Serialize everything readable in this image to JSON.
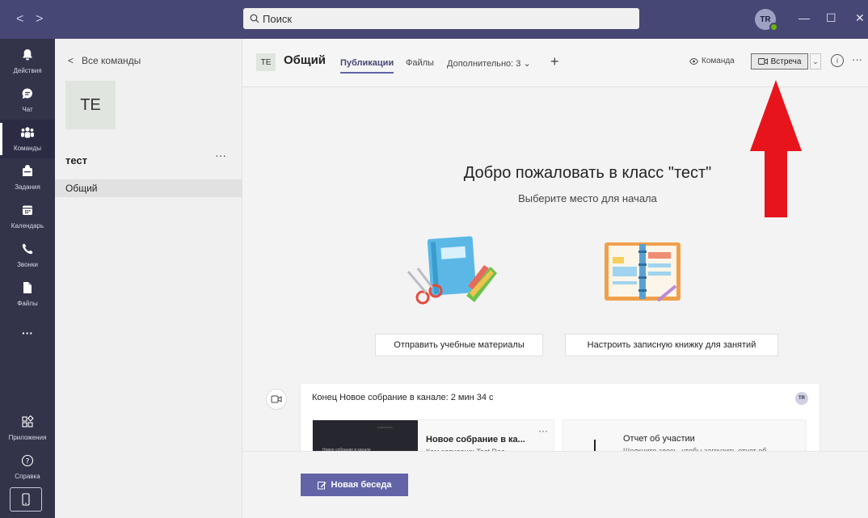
{
  "titlebar": {
    "search_placeholder": "Поиск",
    "avatar_initials": "TR",
    "window_controls": {
      "minimize": "—",
      "maximize": "☐",
      "close": "✕"
    }
  },
  "rail": {
    "items": [
      {
        "label": "Действия",
        "icon": "bell-icon",
        "glyph": "🔔"
      },
      {
        "label": "Чат",
        "icon": "chat-icon",
        "glyph": "💬"
      },
      {
        "label": "Команды",
        "icon": "teams-icon",
        "glyph": "👥"
      },
      {
        "label": "Задания",
        "icon": "assignments-icon",
        "glyph": "🎒"
      },
      {
        "label": "Календарь",
        "icon": "calendar-icon",
        "glyph": "📅"
      },
      {
        "label": "Звонки",
        "icon": "phone-icon",
        "glyph": "📞"
      },
      {
        "label": "Файлы",
        "icon": "file-icon",
        "glyph": "📄"
      },
      {
        "label": "",
        "icon": "more-icon",
        "glyph": "···"
      },
      {
        "label": "Приложения",
        "icon": "apps-icon",
        "glyph": "⊞"
      },
      {
        "label": "Справка",
        "icon": "help-icon",
        "glyph": "?"
      }
    ]
  },
  "team": {
    "back_label": "Все команды",
    "tile_initials": "TE",
    "name": "тест",
    "more": "···",
    "channel": "Общий"
  },
  "channel_header": {
    "avatar": "TE",
    "title": "Общий",
    "tabs": [
      "Публикации",
      "Файлы",
      "Дополнительно: 3 ⌄"
    ],
    "add_tab": "+",
    "team_button": "Команда",
    "meet_button": "Встреча",
    "meet_dropdown": "⌄",
    "info": "i",
    "more": "···"
  },
  "welcome": {
    "title": "Добро пожаловать в класс \"тест\"",
    "subtitle": "Выберите место для начала",
    "button_materials": "Отправить учебные материалы",
    "button_notebook": "Настроить записную книжку для занятий"
  },
  "meeting": {
    "title": "Конец Новое собрание в канале: 2 мин 34 с",
    "avatar": "TR",
    "recording": {
      "thumb_text": "Новое собрание в канале",
      "title": "Новое собрание в ка...",
      "by": "Кем записано: Test Rec",
      "more": "···"
    },
    "report": {
      "title": "Отчет об участии",
      "subtitle": "Щелкните здесь, чтобы загрузить отчет об"
    }
  },
  "composer": {
    "new_conversation": "Новая беседа"
  },
  "colors": {
    "titlebar": "#464775",
    "rail": "#33344a",
    "accent": "#6264a7",
    "arrow": "#e8141c"
  }
}
